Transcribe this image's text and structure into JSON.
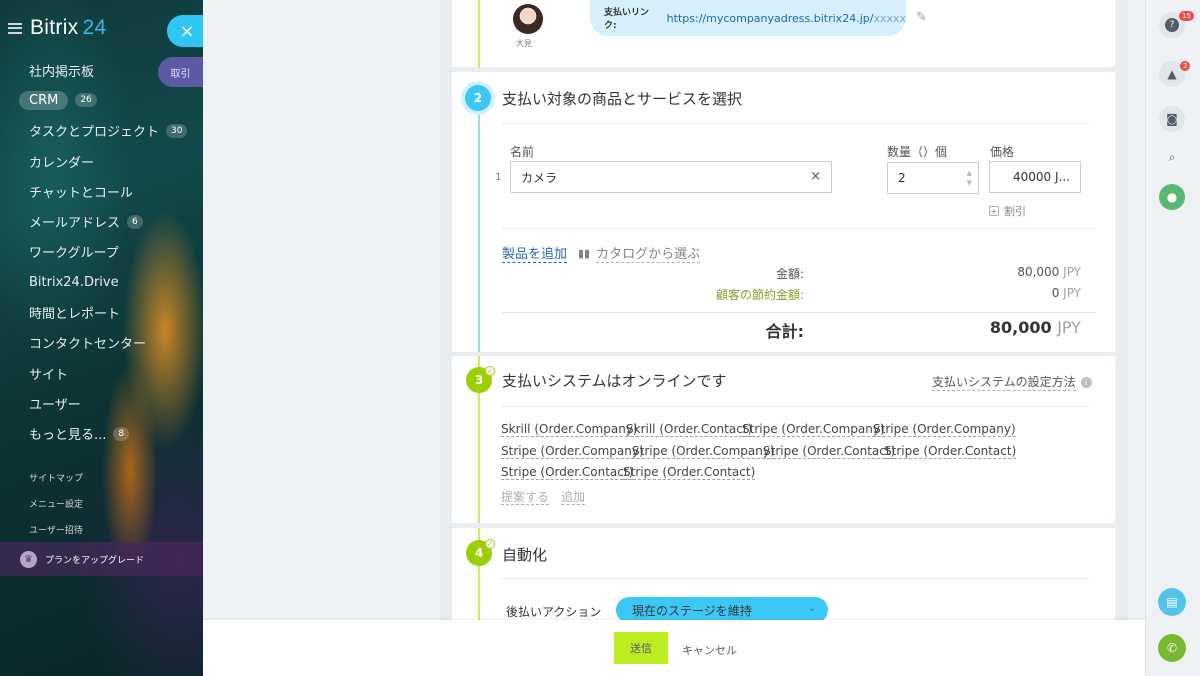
{
  "sidebar": {
    "brand": "Bitrix",
    "brand_num": "24",
    "close_icon": "×",
    "undo_label": "取引",
    "items": [
      {
        "label": "社内掲示板"
      },
      {
        "label": "CRM",
        "badge": "26"
      },
      {
        "label": "タスクとプロジェクト",
        "badge": "30"
      },
      {
        "label": "カレンダー"
      },
      {
        "label": "チャットとコール"
      },
      {
        "label": "メールアドレス",
        "badge": "6"
      },
      {
        "label": "ワークグループ"
      },
      {
        "label": "Bitrix24.Drive"
      },
      {
        "label": "時間とレポート"
      },
      {
        "label": "コンタクトセンター"
      },
      {
        "label": "サイト"
      },
      {
        "label": "ユーザー"
      },
      {
        "label": "もっと見る...",
        "badge": "8"
      }
    ],
    "sitemap": "サイトマップ",
    "menu_settings": "メニュー設定",
    "invite_users": "ユーザー招待",
    "upgrade": "プランをアップグレード"
  },
  "link_card": {
    "avatar_name": "大見",
    "label": "支払いリンク:",
    "url": "https://mycompanyadress.bitrix24.jp/",
    "url_suffix": "xxxxx"
  },
  "step2": {
    "num": "2",
    "title": "支払い対象の商品とサービスを選択",
    "col_name": "名前",
    "col_qty": "数量（）個",
    "col_price": "価格",
    "row_index": "1",
    "product_value": "カメラ",
    "clear_icon": "×",
    "qty_value": "2",
    "price_value": "40000 J...",
    "discount": "割引",
    "add_product": "製品を追加",
    "catalog": "カタログから選ぶ",
    "amount_label": "金額:",
    "amount_value": "80,000",
    "savings_label": "顧客の節約金額:",
    "savings_value": "0",
    "total_label": "合計:",
    "total_value": "80,000",
    "currency": "JPY"
  },
  "step3": {
    "num": "3",
    "title": "支払いシステムはオンラインです",
    "help_link": "支払いシステムの設定方法",
    "systems": [
      "Skrill (Order.Company)",
      "Skrill (Order.Contact)",
      "Stripe (Order.Company)",
      "Stripe (Order.Company)",
      "Stripe (Order.Company)",
      "Stripe (Order.Company)",
      "Stripe (Order.Contact)",
      "Stripe (Order.Contact)",
      "Stripe (Order.Contact)",
      "Stripe (Order.Contact)"
    ],
    "suggest": "提案する",
    "add": "追加"
  },
  "step4": {
    "num": "4",
    "title": "自動化",
    "action_label": "後払いアクション",
    "action_value": "現在のステージを維持"
  },
  "footer": {
    "send": "送信",
    "cancel": "キャンセル"
  },
  "rail": {
    "help_badge": "15",
    "notify_badge": "2"
  },
  "colors": {
    "accent_blue": "#3bc8f5",
    "accent_green": "#9dcf00",
    "send_green": "#bbed21",
    "link_blue": "#2067b0"
  }
}
